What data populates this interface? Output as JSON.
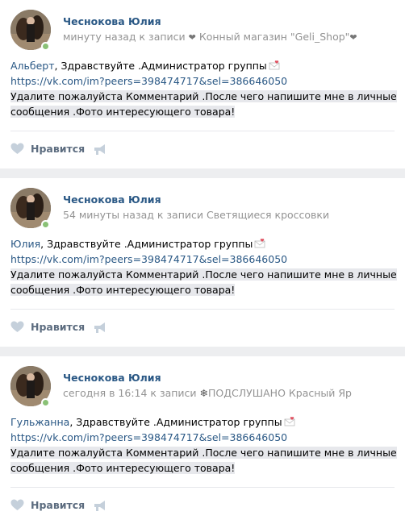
{
  "colors": {
    "link": "#2a5885",
    "muted": "#939393",
    "highlight": "#e7e8ec",
    "online": "#8ac176",
    "action": "#5c6c7f",
    "page_bg": "#edeef0"
  },
  "posts": [
    {
      "author": "Чеснокова Юлия",
      "meta_prefix": "минуту назад к записи ",
      "meta_icon": "heart-icon",
      "meta_group": " Конный магазин \"Geli_Shop\"",
      "meta_suffix_icon": "heart-icon",
      "mention": "Альберт",
      "greeting": ", Здравствуйте .Администратор группы",
      "link": "https://vk.com/im?peers=398474717&sel=386646050",
      "text_line1": "Удалите пожалуйста Комментарий .После чего напишите мне в личные",
      "text_line2": "сообщения .Фото интересующего товара!",
      "like_label": "Нравится"
    },
    {
      "author": "Чеснокова Юлия",
      "meta_prefix": "54 минуты назад к записи Светящиеся кроссовки",
      "mention": "Юлия",
      "greeting": ", Здравствуйте .Администратор группы",
      "link": "https://vk.com/im?peers=398474717&sel=386646050",
      "text_line1": "Удалите пожалуйста Комментарий .После чего напишите мне в личные",
      "text_line2": "сообщения .Фото интересующего товара!",
      "like_label": "Нравится"
    },
    {
      "author": "Чеснокова Юлия",
      "meta_prefix": "сегодня в 16:14 к записи ",
      "meta_icon": "snowflake-icon",
      "meta_group": "ПОДСЛУШАНО Красный Яр",
      "mention": "Гульжанна",
      "greeting": ", Здравствуйте .Администратор группы",
      "link": "https://vk.com/im?peers=398474717&sel=386646050",
      "text_line1": "Удалите пожалуйста Комментарий .После чего напишите мне в личные",
      "text_line2": "сообщения .Фото интересующего товара!",
      "like_label": "Нравится"
    }
  ]
}
